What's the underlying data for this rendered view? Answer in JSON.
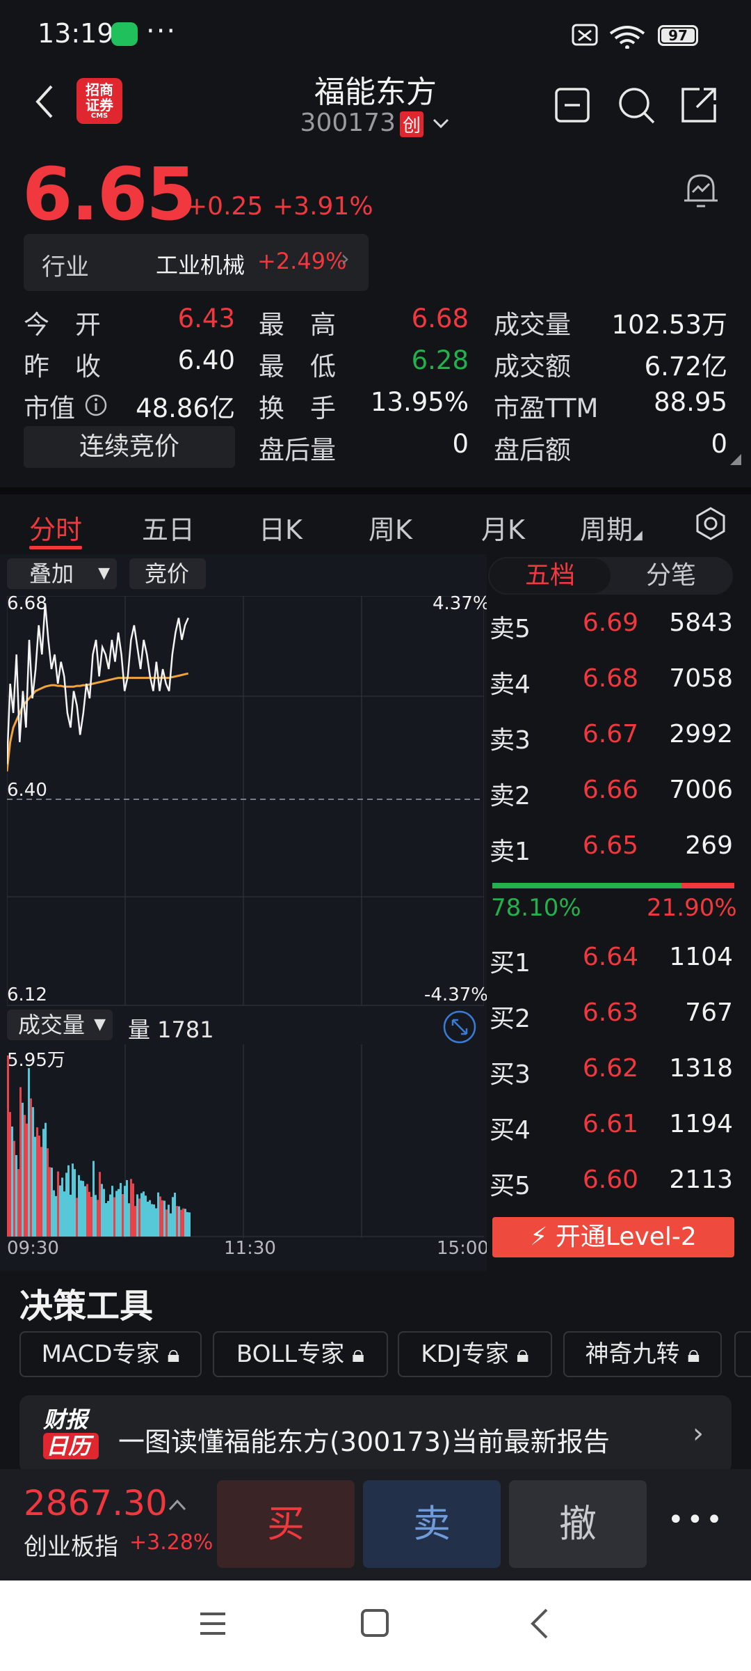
{
  "status_bar": {
    "time": "13:19",
    "battery": "97"
  },
  "header": {
    "broker_logo_line1": "招商",
    "broker_logo_line2": "证券",
    "broker_logo_line3": "CMS",
    "stock_name": "福能东方",
    "stock_code": "300173",
    "board_badge": "创"
  },
  "quote": {
    "price": "6.65",
    "change": "+0.25",
    "change_pct": "+3.91%",
    "industry_label": "行业",
    "industry_name": "工业机械",
    "industry_pct": "+2.49%",
    "stats": [
      {
        "label": "今　开",
        "value": "6.43",
        "color": "#f0383e"
      },
      {
        "label": "最　高",
        "value": "6.68",
        "color": "#f0383e"
      },
      {
        "label": "成交量",
        "value": "102.53万",
        "color": "#f2f2f2"
      },
      {
        "label": "昨　收",
        "value": "6.40",
        "color": "#f2f2f2"
      },
      {
        "label": "最　低",
        "value": "6.28",
        "color": "#22b14c"
      },
      {
        "label": "成交额",
        "value": "6.72亿",
        "color": "#f2f2f2"
      },
      {
        "label": "市值",
        "value": "48.86亿",
        "color": "#f2f2f2"
      },
      {
        "label": "换　手",
        "value": "13.95%",
        "color": "#f2f2f2"
      },
      {
        "label": "市盈TTM",
        "value": "88.95",
        "color": "#f2f2f2"
      },
      {
        "label": "盘后量",
        "value": "0",
        "color": "#f2f2f2"
      },
      {
        "label": "盘后额",
        "value": "0",
        "color": "#f2f2f2"
      }
    ],
    "auction_button": "连续竞价"
  },
  "tabs": [
    "分时",
    "五日",
    "日K",
    "周K",
    "月K",
    "周期"
  ],
  "chart": {
    "overlay_chip": "叠加",
    "auction_chip": "竞价",
    "price_top": "6.68",
    "pct_top": "4.37%",
    "price_mid": "6.40",
    "price_bottom": "6.12",
    "pct_bottom": "-4.37%",
    "volume_chip": "成交量",
    "volume_label": "量 1781",
    "volume_max": "5.95万",
    "time_start": "09:30",
    "time_mid": "11:30",
    "time_end": "15:00"
  },
  "chart_data": {
    "type": "line",
    "series": [
      {
        "values": [
          6.45,
          6.56,
          6.52,
          6.6,
          6.48,
          6.55,
          6.5,
          6.62,
          6.54,
          6.58,
          6.64,
          6.6,
          6.67,
          6.62,
          6.58,
          6.6,
          6.56,
          6.59,
          6.57,
          6.52,
          6.5,
          6.55,
          6.53,
          6.49,
          6.52,
          6.56,
          6.54,
          6.6,
          6.62,
          6.57,
          6.61,
          6.6,
          6.58,
          6.62,
          6.59,
          6.63,
          6.6,
          6.55,
          6.57,
          6.62,
          6.64,
          6.61,
          6.58,
          6.62,
          6.6,
          6.57,
          6.55,
          6.59,
          6.55,
          6.58,
          6.56,
          6.55,
          6.6,
          6.63,
          6.65,
          6.62,
          6.64,
          6.65
        ]
      },
      {
        "values": [
          6.44,
          6.48,
          6.5,
          6.51,
          6.52,
          6.53,
          6.535,
          6.54,
          6.545,
          6.55,
          6.552,
          6.554,
          6.556,
          6.557,
          6.558,
          6.558,
          6.557,
          6.557,
          6.556,
          6.556,
          6.556,
          6.556,
          6.557,
          6.557,
          6.558,
          6.558,
          6.559,
          6.56,
          6.561,
          6.562,
          6.563,
          6.564,
          6.565,
          6.566,
          6.567,
          6.568,
          6.568,
          6.568,
          6.568,
          6.568,
          6.568,
          6.568,
          6.568,
          6.568,
          6.568,
          6.568,
          6.568,
          6.568,
          6.568,
          6.568,
          6.568,
          6.568,
          6.569,
          6.57,
          6.571,
          6.572,
          6.573,
          6.574
        ]
      }
    ],
    "ylim": [
      6.12,
      6.68
    ],
    "volume_ylim": [
      0,
      5.95
    ]
  },
  "order_book": {
    "tab_active": "五档",
    "tab_other": "分笔",
    "sells": [
      {
        "label": "卖5",
        "price": "6.69",
        "vol": "5843"
      },
      {
        "label": "卖4",
        "price": "6.68",
        "vol": "7058"
      },
      {
        "label": "卖3",
        "price": "6.67",
        "vol": "2992"
      },
      {
        "label": "卖2",
        "price": "6.66",
        "vol": "7006"
      },
      {
        "label": "卖1",
        "price": "6.65",
        "vol": "269"
      }
    ],
    "buy_ratio": "78.10%",
    "sell_ratio": "21.90%",
    "buys": [
      {
        "label": "买1",
        "price": "6.64",
        "vol": "1104"
      },
      {
        "label": "买2",
        "price": "6.63",
        "vol": "767"
      },
      {
        "label": "买3",
        "price": "6.62",
        "vol": "1318"
      },
      {
        "label": "买4",
        "price": "6.61",
        "vol": "1194"
      },
      {
        "label": "买5",
        "price": "6.60",
        "vol": "2113"
      }
    ],
    "level2_button": "开通Level-2"
  },
  "tools": {
    "title": "决策工具",
    "items": [
      "MACD专家",
      "BOLL专家",
      "KDJ专家",
      "神奇九转"
    ]
  },
  "report": {
    "logo_line1": "财报",
    "logo_line2": "日历",
    "text": "一图读懂福能东方(300173)当前最新报告"
  },
  "bottom": {
    "index_value": "2867.30",
    "index_name": "创业板指",
    "index_pct": "+3.28%",
    "buy": "买",
    "sell": "卖",
    "cancel": "撤"
  }
}
